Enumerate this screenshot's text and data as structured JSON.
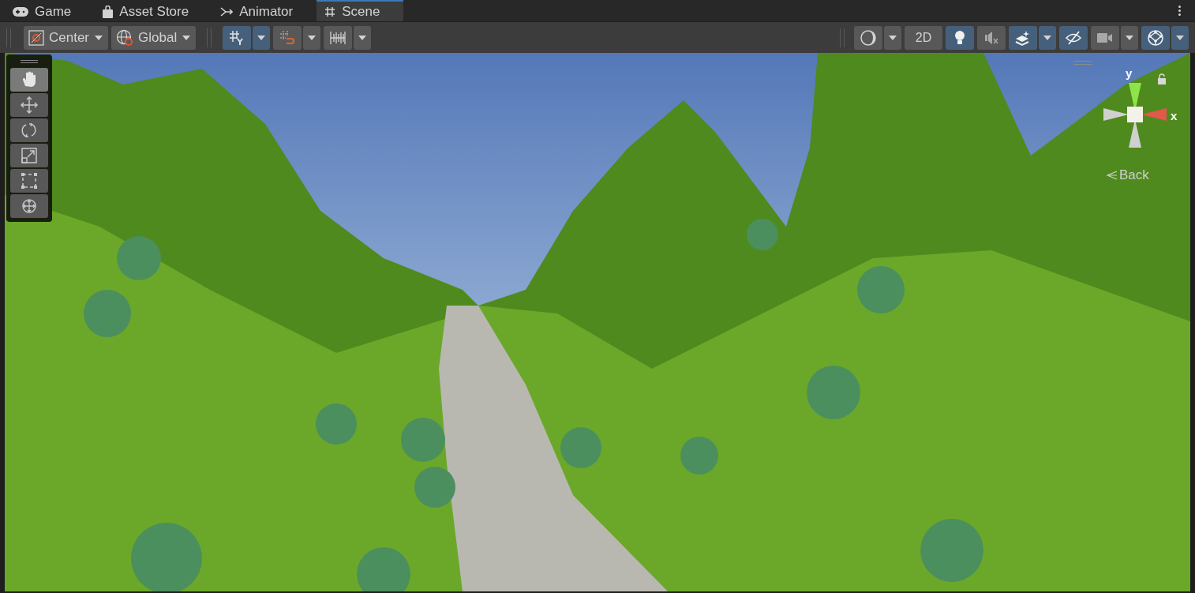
{
  "tabs": [
    {
      "label": "Game",
      "selected": false
    },
    {
      "label": "Asset Store",
      "selected": false
    },
    {
      "label": "Animator",
      "selected": false
    },
    {
      "label": "Scene",
      "selected": true
    }
  ],
  "toolbar": {
    "pivot": {
      "label": "Center"
    },
    "space": {
      "label": "Global"
    },
    "snap_toggles": [
      {
        "kind": "grid-snap",
        "on": true,
        "dropdown": true
      },
      {
        "kind": "increment-snap",
        "on": false,
        "dropdown": true
      },
      {
        "kind": "grid",
        "on": false,
        "dropdown": true
      }
    ],
    "view_toggles": [
      {
        "kind": "shading",
        "on": false,
        "dropdown": true
      },
      {
        "kind": "mode-2d",
        "label": "2D",
        "on": false,
        "dropdown": false
      },
      {
        "kind": "lighting",
        "on": true,
        "dropdown": false
      },
      {
        "kind": "audio",
        "on": false,
        "dropdown": false
      },
      {
        "kind": "effects",
        "on": true,
        "dropdown": true
      },
      {
        "kind": "visibility",
        "on": true,
        "dropdown": false
      },
      {
        "kind": "camera",
        "on": false,
        "dropdown": true
      },
      {
        "kind": "gizmos",
        "on": true,
        "dropdown": true
      }
    ]
  },
  "tools": [
    {
      "kind": "hand",
      "selected": true
    },
    {
      "kind": "move",
      "selected": false
    },
    {
      "kind": "rotate",
      "selected": false
    },
    {
      "kind": "scale",
      "selected": false
    },
    {
      "kind": "rect",
      "selected": false
    },
    {
      "kind": "transform",
      "selected": false
    }
  ],
  "orientation_gizmo": {
    "y_label": "y",
    "x_label": "x",
    "view_label": "Back"
  }
}
